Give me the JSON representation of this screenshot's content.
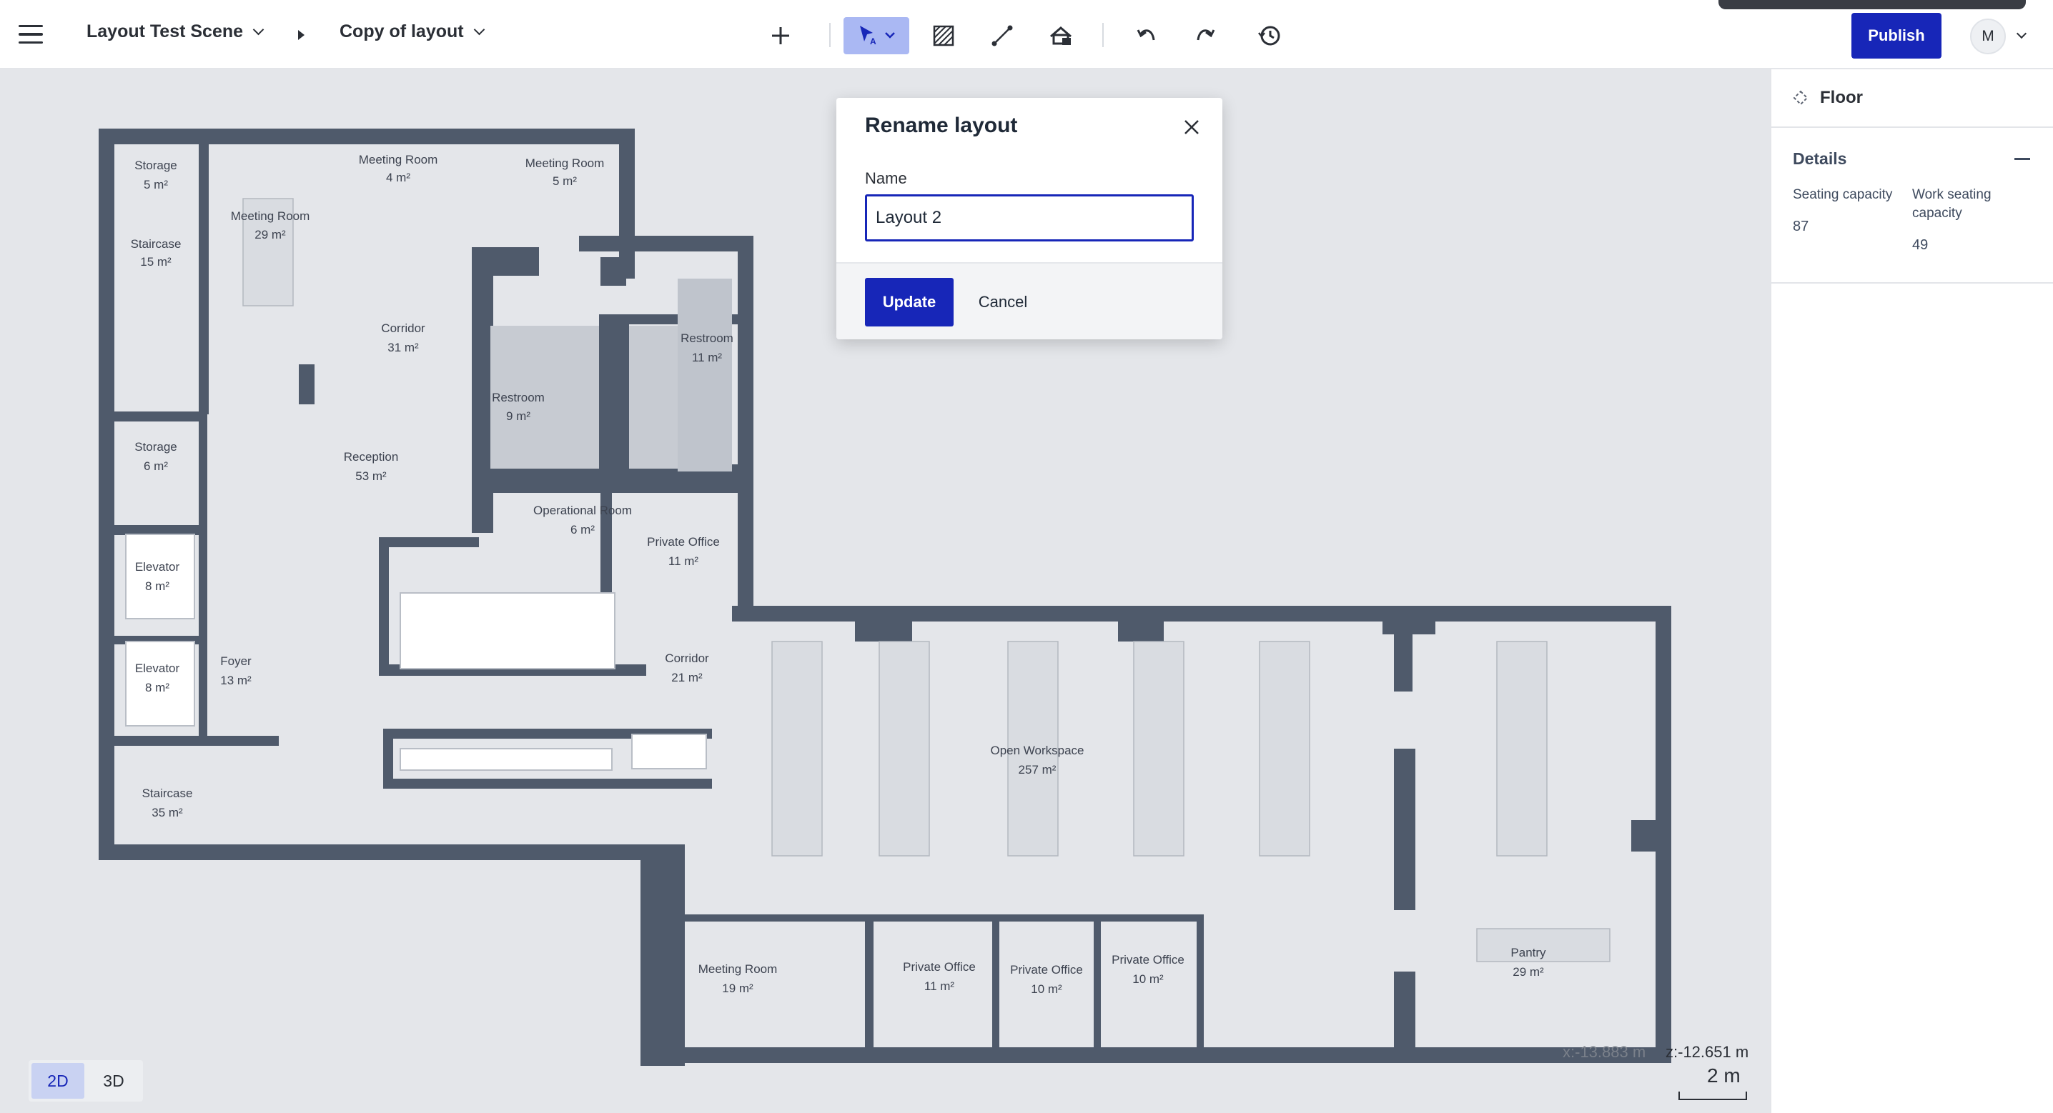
{
  "header": {
    "scene_name": "Layout Test Scene",
    "layout_name": "Copy of layout",
    "publish_label": "Publish",
    "avatar_initial": "M"
  },
  "toolbar": {
    "tools": [
      "plus-icon",
      "select-cursor-icon",
      "hatch-area-icon",
      "line-draw-icon",
      "furniture-icon",
      "undo-icon",
      "redo-icon",
      "history-icon"
    ],
    "active_tool": "select-cursor-icon",
    "accent": "#1726b8",
    "active_bg": "#aab8f3"
  },
  "modal": {
    "title": "Rename layout",
    "name_label": "Name",
    "name_value": "Layout 2",
    "update_label": "Update",
    "cancel_label": "Cancel"
  },
  "panel": {
    "title": "Floor",
    "details_title": "Details",
    "seating_label": "Seating capacity",
    "seating_value": "87",
    "work_label": "Work seating capacity",
    "work_value": "49"
  },
  "rooms": [
    {
      "name": "Storage",
      "area": "5 m²"
    },
    {
      "name": "Meeting Room",
      "area": "29 m²"
    },
    {
      "name": "Meeting Room",
      "area": "4 m²"
    },
    {
      "name": "Meeting Room",
      "area": "5 m²"
    },
    {
      "name": "Staircase",
      "area": "15 m²"
    },
    {
      "name": "Corridor",
      "area": "31 m²"
    },
    {
      "name": "Restroom",
      "area": "11 m²"
    },
    {
      "name": "Restroom",
      "area": "9 m²"
    },
    {
      "name": "Storage",
      "area": "6 m²"
    },
    {
      "name": "Reception",
      "area": "53 m²"
    },
    {
      "name": "Operational Room",
      "area": "6 m²"
    },
    {
      "name": "Private Office",
      "area": "11 m²"
    },
    {
      "name": "Elevator",
      "area": "8 m²"
    },
    {
      "name": "Elevator",
      "area": "8 m²"
    },
    {
      "name": "Foyer",
      "area": "13 m²"
    },
    {
      "name": "Corridor",
      "area": "21 m²"
    },
    {
      "name": "Open Workspace",
      "area": "257 m²"
    },
    {
      "name": "Staircase",
      "area": "35 m²"
    },
    {
      "name": "Meeting Room",
      "area": "19 m²"
    },
    {
      "name": "Private Office",
      "area": "11 m²"
    },
    {
      "name": "Private Office",
      "area": "10 m²"
    },
    {
      "name": "Private Office",
      "area": "10 m²"
    },
    {
      "name": "Pantry",
      "area": "29 m²"
    }
  ],
  "view": {
    "mode_2d": "2D",
    "mode_3d": "3D",
    "active_mode": "2D"
  },
  "status": {
    "x_coord": "x:-13.883 m",
    "z_coord": "z:-12.651 m",
    "scale_label": "2 m"
  }
}
